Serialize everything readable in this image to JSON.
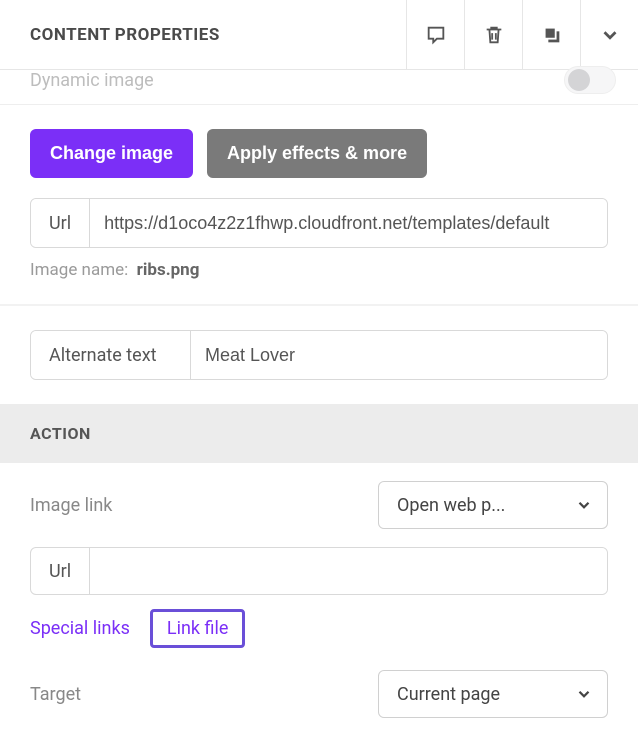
{
  "header": {
    "title": "CONTENT PROPERTIES"
  },
  "dynamicImage": {
    "label": "Dynamic image"
  },
  "image": {
    "changeBtn": "Change image",
    "effectsBtn": "Apply effects & more",
    "urlLabel": "Url",
    "urlValue": "https://d1oco4z2z1fhwp.cloudfront.net/templates/default",
    "nameLabel": "Image name:",
    "nameValue": "ribs.png",
    "altLabel": "Alternate text",
    "altValue": "Meat Lover"
  },
  "action": {
    "sectionTitle": "ACTION",
    "imageLinkLabel": "Image link",
    "imageLinkValue": "Open web p...",
    "urlLabel": "Url",
    "urlValue": "",
    "specialLinks": "Special links",
    "linkFile": "Link file",
    "targetLabel": "Target",
    "targetValue": "Current page"
  }
}
